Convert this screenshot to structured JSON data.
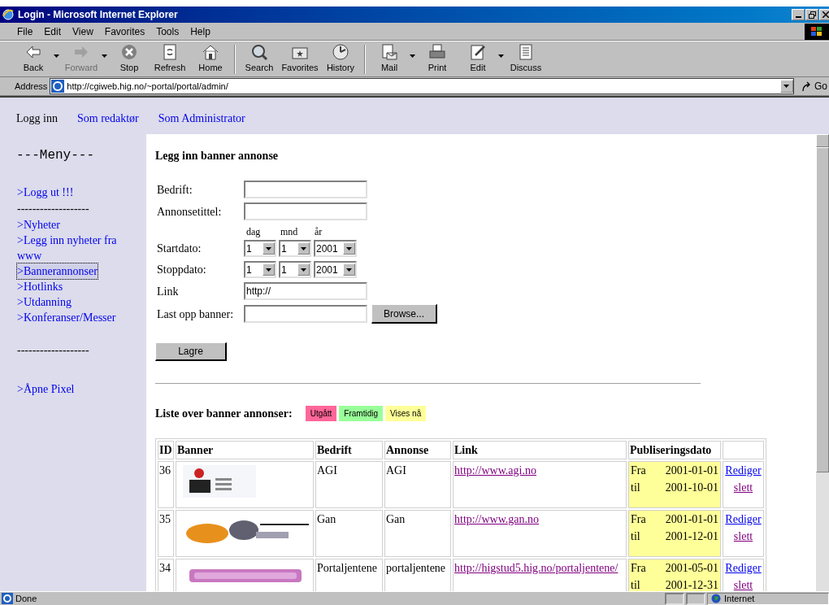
{
  "window": {
    "title": "Login - Microsoft Internet Explorer"
  },
  "menu": [
    "File",
    "Edit",
    "View",
    "Favorites",
    "Tools",
    "Help"
  ],
  "toolbar": [
    {
      "label": "Back",
      "kind": "back",
      "disabled": false,
      "dropdown": true
    },
    {
      "label": "Forward",
      "kind": "forward",
      "disabled": true,
      "dropdown": true
    },
    {
      "label": "Stop",
      "kind": "stop",
      "disabled": false,
      "dropdown": false
    },
    {
      "label": "Refresh",
      "kind": "refresh",
      "disabled": false,
      "dropdown": false
    },
    {
      "label": "Home",
      "kind": "home",
      "disabled": false,
      "dropdown": false
    },
    {
      "label": "Search",
      "kind": "search",
      "disabled": false,
      "dropdown": false
    },
    {
      "label": "Favorites",
      "kind": "favorites",
      "disabled": false,
      "dropdown": false
    },
    {
      "label": "History",
      "kind": "history",
      "disabled": false,
      "dropdown": false
    },
    {
      "label": "Mail",
      "kind": "mail",
      "disabled": false,
      "dropdown": true
    },
    {
      "label": "Print",
      "kind": "print",
      "disabled": false,
      "dropdown": false
    },
    {
      "label": "Edit",
      "kind": "edit",
      "disabled": false,
      "dropdown": true
    },
    {
      "label": "Discuss",
      "kind": "discuss",
      "disabled": false,
      "dropdown": false
    }
  ],
  "address": {
    "label": "Address",
    "value": "http://cgiweb.hig.no/~portal/portal/admin/",
    "go": "Go"
  },
  "topnav": [
    {
      "label": "Logg inn",
      "kind": "text"
    },
    {
      "label": "Som redaktør",
      "kind": "link"
    },
    {
      "label": "Som Administrator",
      "kind": "link"
    }
  ],
  "sidebar": {
    "heading": "---Meny---",
    "items": [
      {
        "label": ">Logg ut !!!",
        "kind": "link",
        "selected": false
      },
      {
        "label": "-------------------",
        "kind": "divider",
        "selected": false
      },
      {
        "label": ">Nyheter",
        "kind": "link",
        "selected": false
      },
      {
        "label": ">Legg inn nyheter fra www",
        "kind": "link",
        "selected": false
      },
      {
        "label": ">Bannerannonser",
        "kind": "link",
        "selected": true
      },
      {
        "label": ">Hotlinks",
        "kind": "link",
        "selected": false
      },
      {
        "label": ">Utdanning",
        "kind": "link",
        "selected": false
      },
      {
        "label": ">Konferanser/Messer",
        "kind": "link",
        "selected": false
      },
      {
        "label": "-------------------",
        "kind": "divider",
        "selected": false
      },
      {
        "label": ">Åpne Pixel",
        "kind": "link",
        "selected": false
      }
    ]
  },
  "form": {
    "title": "Legg inn banner annonse",
    "fields": [
      {
        "label": "Bedrift:",
        "kind": "text"
      },
      {
        "label": "Annonsetittel:",
        "kind": "text"
      },
      {
        "kind": "date_header",
        "parts": [
          "dag",
          "mnd",
          "år"
        ]
      },
      {
        "label": "Startdato:",
        "kind": "date",
        "parts": [
          "1",
          "1",
          "2001"
        ]
      },
      {
        "label": "Stoppdato:",
        "kind": "date",
        "parts": [
          "1",
          "1",
          "2001"
        ]
      },
      {
        "label": "Link",
        "kind": "text",
        "value": "http://"
      },
      {
        "label": "Last opp banner:",
        "kind": "file",
        "button": "Browse..."
      }
    ],
    "submit": "Lagre"
  },
  "list": {
    "title": "Liste over banner annonser:",
    "legend": [
      {
        "label": "Utgått",
        "color": "#ff6699"
      },
      {
        "label": "Framtidig",
        "color": "#99ff99"
      },
      {
        "label": "Vises nå",
        "color": "#ffff99"
      }
    ],
    "columns": [
      "ID",
      "Banner",
      "Bedrift",
      "Annonse",
      "Link",
      "Publiseringsdato"
    ],
    "rows": [
      {
        "id": "36",
        "bedrift": "AGI",
        "annonse": "AGI",
        "link": "http://www.agi.no",
        "color": "#ffff99",
        "from_label": "Fra",
        "from": "2001-01-01",
        "to_label": "til",
        "to": "2001-10-01",
        "edit": "Rediger",
        "delete": "slett"
      },
      {
        "id": "35",
        "bedrift": "Gan",
        "annonse": "Gan",
        "link": "http://www.gan.no",
        "color": "#ffff99",
        "from_label": "Fra",
        "from": "2001-01-01",
        "to_label": "til",
        "to": "2001-12-01",
        "edit": "Rediger",
        "delete": "slett"
      },
      {
        "id": "34",
        "bedrift": "Portaljentene",
        "annonse": "portaljentene",
        "link": "http://higstud5.hig.no/portaljentene/",
        "color": "#ffff99",
        "from_label": "Fra",
        "from": "2001-05-01",
        "to_label": "til",
        "to": "2001-12-31",
        "edit": "Rediger",
        "delete": "slett"
      }
    ]
  },
  "status_bar": {
    "text": "Done",
    "zone": "Internet"
  }
}
